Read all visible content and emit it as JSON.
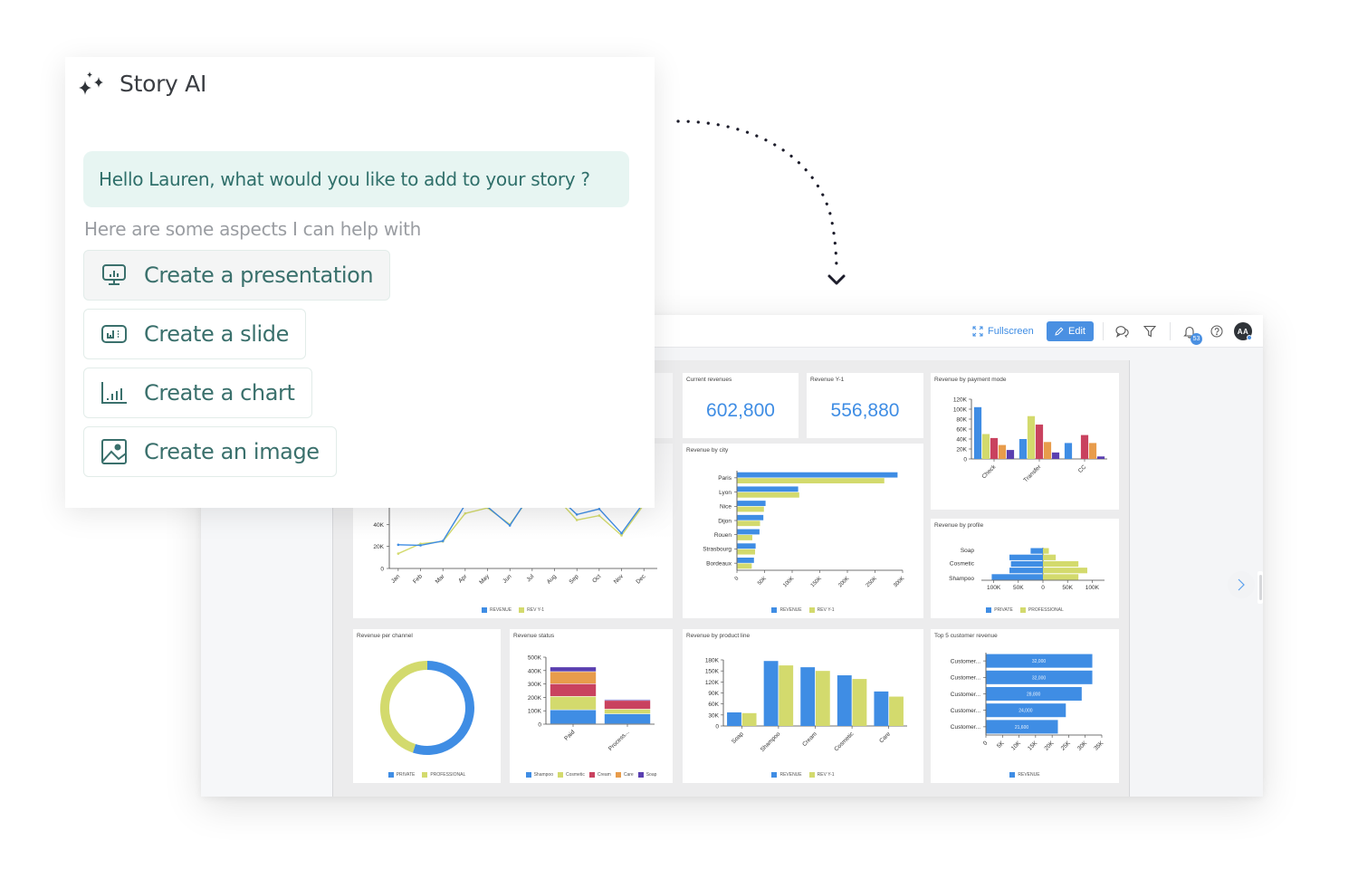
{
  "story_ai": {
    "title": "Story AI",
    "greeting": "Hello Lauren, what would you like to add to your story ?",
    "help_text": "Here are some aspects I can help with",
    "actions": [
      {
        "label": "Create a presentation",
        "icon": "presentation-icon"
      },
      {
        "label": "Create a slide",
        "icon": "slide-icon"
      },
      {
        "label": "Create a chart",
        "icon": "bar-chart-icon"
      },
      {
        "label": "Create an image",
        "icon": "image-icon"
      }
    ]
  },
  "toolbar": {
    "fullscreen_label": "Fullscreen",
    "edit_label": "Edit",
    "notification_count": "53",
    "avatar_initials": "AA"
  },
  "colors": {
    "accent": "#4a90e2",
    "series_blue": "#3f8de4",
    "series_green": "#d3da6d",
    "series_red": "#c9425f",
    "series_orange": "#e89c4b",
    "series_purple": "#5a3fb0",
    "ai_text": "#3a706c",
    "ai_bubble": "#e7f5f2"
  },
  "kpis": [
    {
      "title": "Current revenues",
      "value": "602,800"
    },
    {
      "title": "Revenue Y-1",
      "value": "556,880"
    }
  ],
  "chart_data": [
    {
      "id": "payment",
      "type": "bar",
      "title": "Revenue by payment mode",
      "categories": [
        "Check",
        "Transfer",
        "CC"
      ],
      "series": [
        {
          "name": "Shampoo",
          "color": "#3f8de4",
          "values": [
            104000,
            40000,
            32000
          ]
        },
        {
          "name": "Cosmetic",
          "color": "#d3da6d",
          "values": [
            50000,
            86000,
            0
          ]
        },
        {
          "name": "Cream",
          "color": "#c9425f",
          "values": [
            42000,
            69000,
            48000
          ]
        },
        {
          "name": "Care",
          "color": "#e89c4b",
          "values": [
            28000,
            34000,
            32000
          ]
        },
        {
          "name": "Soap",
          "color": "#5a3fb0",
          "values": [
            18000,
            13000,
            5000
          ]
        }
      ],
      "yticks": [
        "0",
        "20K",
        "40K",
        "60K",
        "80K",
        "100K",
        "120K"
      ],
      "ylim": [
        0,
        120000
      ]
    },
    {
      "id": "city",
      "type": "bar",
      "orientation": "horizontal",
      "title": "Revenue by city",
      "categories": [
        "Paris",
        "Lyon",
        "Nice",
        "Dijon",
        "Rouen",
        "Strasbourg",
        "Bordeaux"
      ],
      "series": [
        {
          "name": "REVENUE",
          "color": "#3f8de4",
          "values": [
            290000,
            110000,
            51000,
            47000,
            40000,
            33000,
            30000
          ]
        },
        {
          "name": "REV Y-1",
          "color": "#d3da6d",
          "values": [
            266000,
            112000,
            48000,
            41000,
            27000,
            32000,
            26000
          ]
        }
      ],
      "xticks": [
        "0",
        "50K",
        "100K",
        "150K",
        "200K",
        "250K",
        "300K"
      ],
      "xlim": [
        0,
        300000
      ]
    },
    {
      "id": "profile",
      "type": "bar",
      "orientation": "horizontal-diverging",
      "title": "Revenue by profile",
      "categories": [
        "Soap",
        "Cosmetic",
        "Shampoo"
      ],
      "rows": [
        {
          "private": 25000,
          "professional": 12000
        },
        {
          "private": 68000,
          "professional": 26000
        },
        {
          "private": 65000,
          "professional": 72000
        },
        {
          "private": 68000,
          "professional": 90000
        },
        {
          "private": 104000,
          "professional": 72000
        }
      ],
      "series": [
        {
          "name": "PRIVATE",
          "color": "#3f8de4"
        },
        {
          "name": "PROFESSIONAL",
          "color": "#d3da6d"
        }
      ],
      "xticks": [
        "100K",
        "50K",
        "0",
        "50K",
        "100K"
      ],
      "xlim": [
        -125000,
        125000
      ]
    },
    {
      "id": "monthly",
      "type": "line",
      "title": "",
      "categories": [
        "Jan",
        "Feb",
        "Mar",
        "Apr",
        "May",
        "Jun",
        "Jul",
        "Aug",
        "Sep",
        "Oct",
        "Nov",
        "Dec"
      ],
      "series": [
        {
          "name": "REVENUE",
          "color": "#3f8de4",
          "values": [
            21500,
            21000,
            25000,
            58000,
            56000,
            39000,
            70000,
            68000,
            49000,
            54000,
            32000,
            60000
          ]
        },
        {
          "name": "REV Y-1",
          "color": "#d3da6d",
          "values": [
            13500,
            22500,
            24500,
            50000,
            55000,
            40000,
            68000,
            66000,
            44000,
            48000,
            30000,
            58000
          ]
        }
      ],
      "yticks": [
        "0",
        "20K",
        "40K"
      ],
      "ylim": [
        0,
        60000
      ]
    },
    {
      "id": "channel",
      "type": "pie",
      "donut": true,
      "title": "Revenue per channel",
      "categories": [
        "PRIVATE",
        "PROFESSIONAL"
      ],
      "values": [
        55,
        45
      ],
      "colors": [
        "#3f8de4",
        "#d3da6d"
      ]
    },
    {
      "id": "status",
      "type": "bar",
      "stacked": true,
      "title": "Revenue status",
      "categories": [
        "Paid",
        "Process..."
      ],
      "series": [
        {
          "name": "Shampoo",
          "color": "#3f8de4",
          "values": [
            105000,
            75000
          ]
        },
        {
          "name": "Cosmetic",
          "color": "#d3da6d",
          "values": [
            100000,
            35000
          ]
        },
        {
          "name": "Cream",
          "color": "#c9425f",
          "values": [
            95000,
            65000
          ]
        },
        {
          "name": "Care",
          "color": "#e89c4b",
          "values": [
            90000,
            0
          ]
        },
        {
          "name": "Soap",
          "color": "#5a3fb0",
          "values": [
            35000,
            8000
          ]
        }
      ],
      "yticks": [
        "0",
        "100K",
        "200K",
        "300K",
        "400K",
        "500K"
      ],
      "ylim": [
        0,
        500000
      ]
    },
    {
      "id": "product",
      "type": "bar",
      "title": "Revenue by product line",
      "categories": [
        "Soap",
        "Shampoo",
        "Cream",
        "Cosmetic",
        "Care"
      ],
      "series": [
        {
          "name": "REVENUE",
          "color": "#3f8de4",
          "values": [
            37000,
            177000,
            160000,
            138000,
            94000
          ]
        },
        {
          "name": "REV Y-1",
          "color": "#d3da6d",
          "values": [
            35000,
            165000,
            150000,
            128000,
            80000
          ]
        }
      ],
      "yticks": [
        "0",
        "30K",
        "60K",
        "90K",
        "120K",
        "150K",
        "180K"
      ],
      "ylim": [
        0,
        180000
      ]
    },
    {
      "id": "customers",
      "type": "bar",
      "orientation": "horizontal",
      "title": "Top 5 customer revenue",
      "categories": [
        "Customer...",
        "Customer...",
        "Customer...",
        "Customer...",
        "Customer..."
      ],
      "series": [
        {
          "name": "REVENUE",
          "color": "#3f8de4",
          "values": [
            32000,
            32000,
            28800,
            24000,
            21600
          ]
        }
      ],
      "data_labels": [
        "32,000",
        "32,000",
        "28,800",
        "24,000",
        "21,600"
      ],
      "xticks": [
        "0",
        "5K",
        "10K",
        "15K",
        "20K",
        "25K",
        "30K",
        "35K"
      ],
      "xlim": [
        0,
        35000
      ]
    }
  ]
}
